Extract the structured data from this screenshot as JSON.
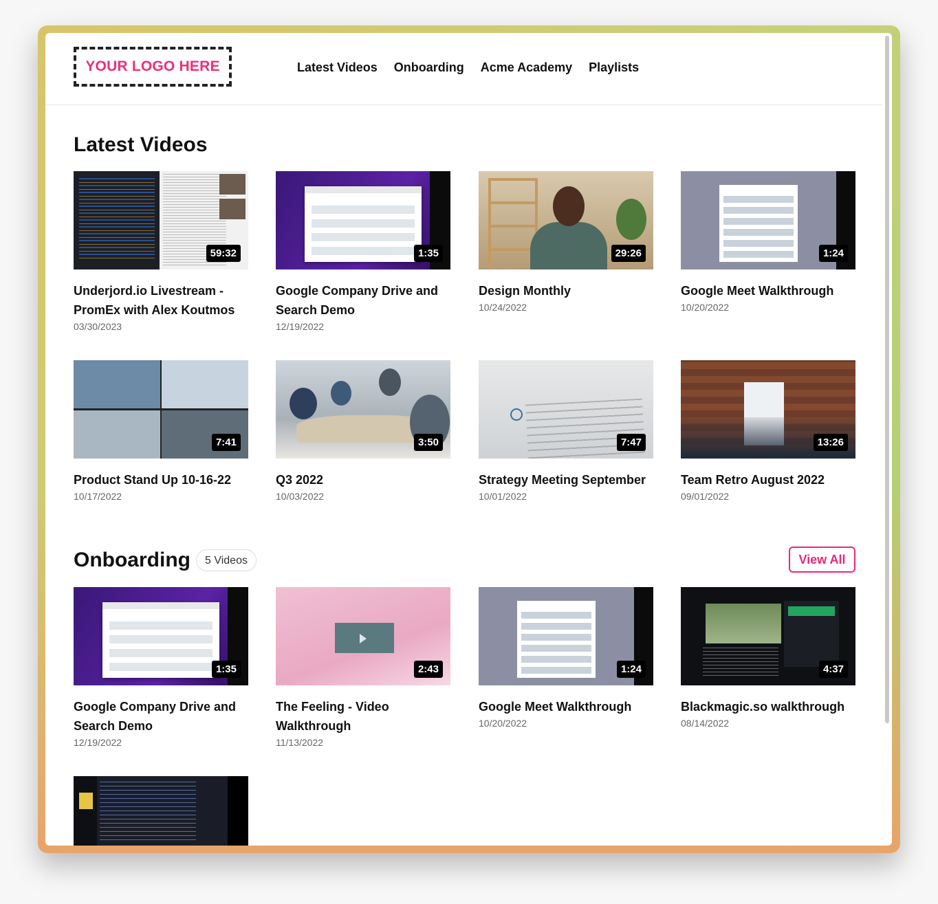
{
  "header": {
    "logo_text": "YOUR LOGO HERE",
    "nav": [
      "Latest Videos",
      "Onboarding",
      "Acme Academy",
      "Playlists"
    ]
  },
  "latest": {
    "heading": "Latest Videos",
    "videos": [
      {
        "title": "Underjord.io Livestream - PromEx with Alex Koutmos",
        "date": "03/30/2023",
        "duration": "59:32"
      },
      {
        "title": "Google Company Drive and Search Demo",
        "date": "12/19/2022",
        "duration": "1:35"
      },
      {
        "title": "Design Monthly",
        "date": "10/24/2022",
        "duration": "29:26"
      },
      {
        "title": "Google Meet Walkthrough",
        "date": "10/20/2022",
        "duration": "1:24"
      },
      {
        "title": "Product Stand Up 10-16-22",
        "date": "10/17/2022",
        "duration": "7:41"
      },
      {
        "title": "Q3 2022",
        "date": "10/03/2022",
        "duration": "3:50"
      },
      {
        "title": "Strategy Meeting September",
        "date": "10/01/2022",
        "duration": "7:47"
      },
      {
        "title": "Team Retro August 2022",
        "date": "09/01/2022",
        "duration": "13:26"
      }
    ]
  },
  "onboarding": {
    "heading": "Onboarding",
    "count_badge": "5 Videos",
    "view_all": "View All",
    "videos": [
      {
        "title": "Google Company Drive and Search Demo",
        "date": "12/19/2022",
        "duration": "1:35"
      },
      {
        "title": "The Feeling - Video Walkthrough",
        "date": "11/13/2022",
        "duration": "2:43"
      },
      {
        "title": "Google Meet Walkthrough",
        "date": "10/20/2022",
        "duration": "1:24"
      },
      {
        "title": "Blackmagic.so walkthrough",
        "date": "08/14/2022",
        "duration": "4:37"
      }
    ]
  },
  "colors": {
    "accent": "#e8287a",
    "logo": "#ee2e7b"
  }
}
